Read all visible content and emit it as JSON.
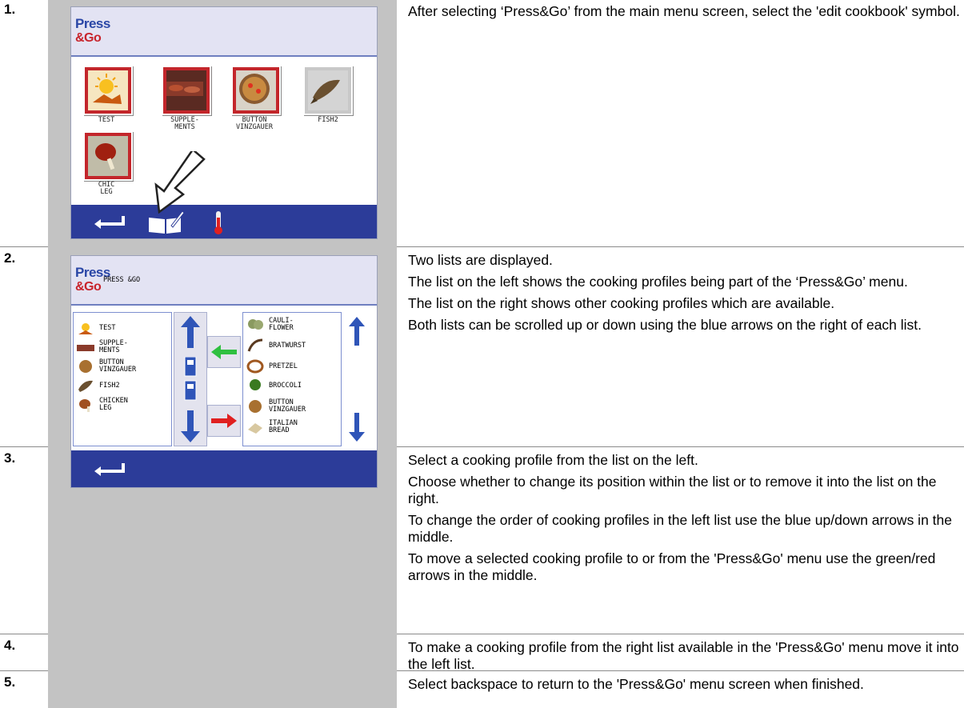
{
  "steps": [
    {
      "num": "1.",
      "paragraphs": [
        "After selecting ‘Press&Go’ from the main menu screen, select the 'edit cookbook' symbol."
      ]
    },
    {
      "num": "2.",
      "paragraphs": [
        "Two lists are displayed.",
        "The list on the left shows the cooking profiles being part of the ‘Press&Go’ menu.",
        "The list on the right shows other cooking profiles which are available.",
        "Both lists can be scrolled up or down using the blue arrows on the right of each list."
      ]
    },
    {
      "num": "3.",
      "paragraphs": [
        "Select a cooking profile from the list on the left.",
        "Choose whether to change its position within the list or to remove it into the list on the right.",
        "To change the order of cooking profiles in the left list use the blue up/down arrows in the middle.",
        "To move a selected cooking profile to or from the 'Press&Go' menu use the green/red arrows in the middle."
      ]
    },
    {
      "num": "4.",
      "paragraphs": [
        "To make a cooking profile from the right list available in the 'Press&Go' menu move it into the left list."
      ]
    },
    {
      "num": "5.",
      "paragraphs": [
        "Select backspace to return to the 'Press&Go' menu screen when finished."
      ]
    }
  ],
  "screen1": {
    "logo_top": "Press",
    "logo_bottom": "&Go",
    "tiles": [
      {
        "label": "TEST"
      },
      {
        "label": "SUPPLE-\nMENTS"
      },
      {
        "label": "BUTTON\nVINZGAUER"
      },
      {
        "label": "FISH2"
      },
      {
        "label": "CHIC\nLEG"
      }
    ]
  },
  "screen2": {
    "logo_top": "Press",
    "logo_bottom": "&Go",
    "header_text": "PRESS &GO",
    "left_list": [
      "TEST",
      "SUPPLE-\nMENTS",
      "BUTTON\nVINZGAUER",
      "FISH2",
      "CHICKEN\nLEG"
    ],
    "right_list": [
      "CAULI-\nFLOWER",
      "BRATWURST",
      "PRETZEL",
      "BROCCOLI",
      "BUTTON\nVINZGAUER",
      "ITALIAN\nBREAD"
    ]
  },
  "colors": {
    "footer": "#2c3c99",
    "arrow_blue": "#2f55b8",
    "arrow_green": "#2fc040",
    "arrow_red": "#e02020",
    "tile_red": "#c3262b"
  }
}
